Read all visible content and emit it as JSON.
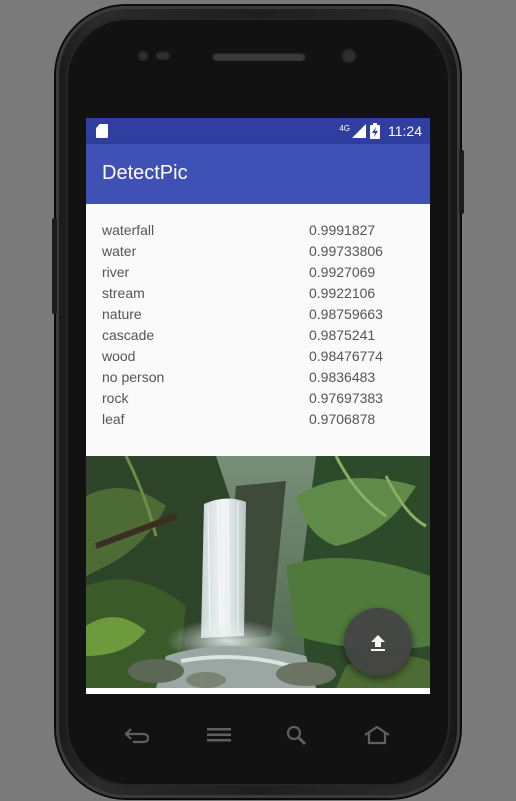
{
  "status_bar": {
    "network": "4G",
    "time": "11:24"
  },
  "app_bar": {
    "title": "DetectPic"
  },
  "results": [
    {
      "label": "waterfall",
      "score": "0.9991827"
    },
    {
      "label": "water",
      "score": "0.99733806"
    },
    {
      "label": "river",
      "score": "0.9927069"
    },
    {
      "label": "stream",
      "score": "0.9922106"
    },
    {
      "label": "nature",
      "score": "0.98759663"
    },
    {
      "label": "cascade",
      "score": "0.9875241"
    },
    {
      "label": "wood",
      "score": "0.98476774"
    },
    {
      "label": "no person",
      "score": "0.9836483"
    },
    {
      "label": "rock",
      "score": "0.97697383"
    },
    {
      "label": "leaf",
      "score": "0.9706878"
    }
  ],
  "colors": {
    "status_bar": "#303f9f",
    "app_bar": "#3f51b5",
    "fab": "#454545"
  },
  "icons": {
    "fab": "upload-icon",
    "status_left": "sd-card-icon",
    "nav": [
      "back-icon",
      "menu-icon",
      "search-icon",
      "home-icon"
    ]
  }
}
